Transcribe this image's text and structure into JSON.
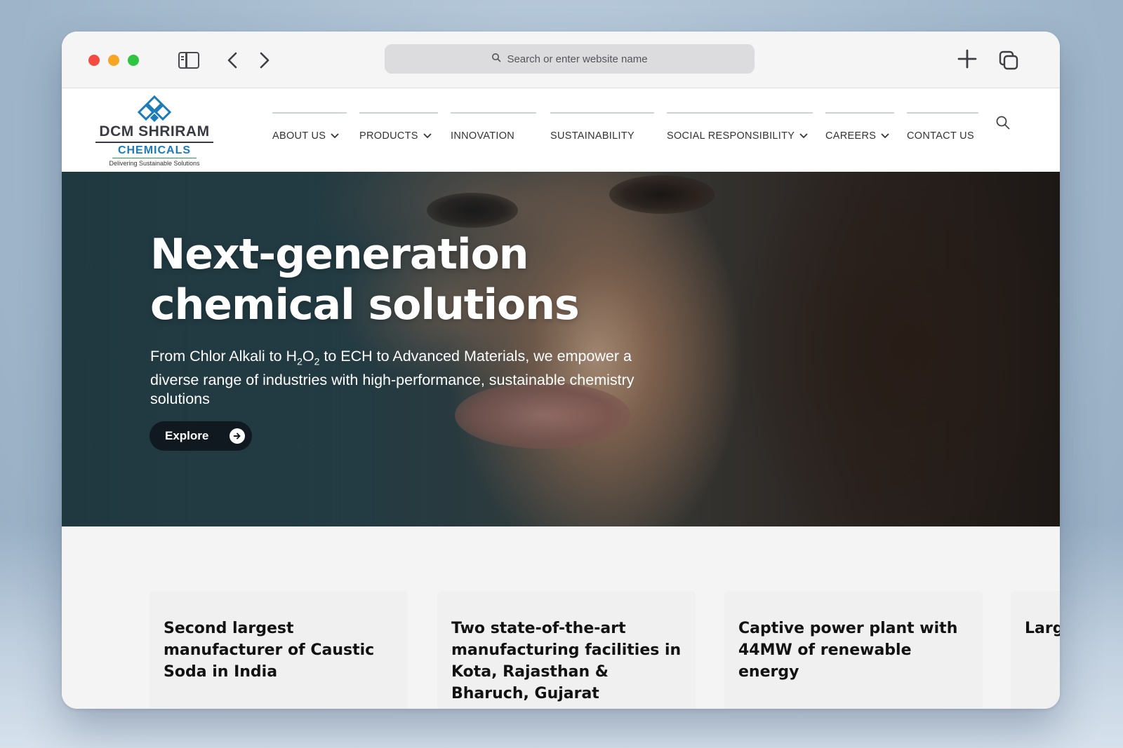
{
  "browser": {
    "url_placeholder": "Search or enter website name"
  },
  "logo": {
    "name": "DCM SHRIRAM",
    "sub": "CHEMICALS",
    "tagline": "Delivering Sustainable Solutions"
  },
  "nav": {
    "items": [
      {
        "label": "ABOUT US",
        "dropdown": true
      },
      {
        "label": "PRODUCTS",
        "dropdown": true
      },
      {
        "label": "INNOVATION",
        "dropdown": false
      },
      {
        "label": "SUSTAINABILITY",
        "dropdown": false
      },
      {
        "label": "SOCIAL RESPONSIBILITY",
        "dropdown": true
      },
      {
        "label": "CAREERS",
        "dropdown": true
      },
      {
        "label": "CONTACT US",
        "dropdown": false
      }
    ]
  },
  "hero": {
    "title_line1": "Next-generation",
    "title_line2": "chemical solutions",
    "subtitle_part1": "From Chlor Alkali to H",
    "subtitle_sub1": "2",
    "subtitle_part2": "O",
    "subtitle_sub2": "2",
    "subtitle_part3": " to ECH to Advanced Materials, we empower a diverse range of industries with high-performance, sustainable chemistry solutions",
    "cta_label": "Explore"
  },
  "cards": [
    {
      "text": "Second largest manufacturer of Caustic Soda in India"
    },
    {
      "text": "Two state-of-the-art manufacturing facilities in Kota, Rajasthan & Bharuch, Gujarat"
    },
    {
      "text": "Captive power plant with 44MW of renewable energy"
    },
    {
      "text": "Larg com Bha"
    }
  ],
  "colors": {
    "brand_blue": "#1a7bb8",
    "brand_green": "#2b9b56",
    "cta_bg": "#101820"
  }
}
